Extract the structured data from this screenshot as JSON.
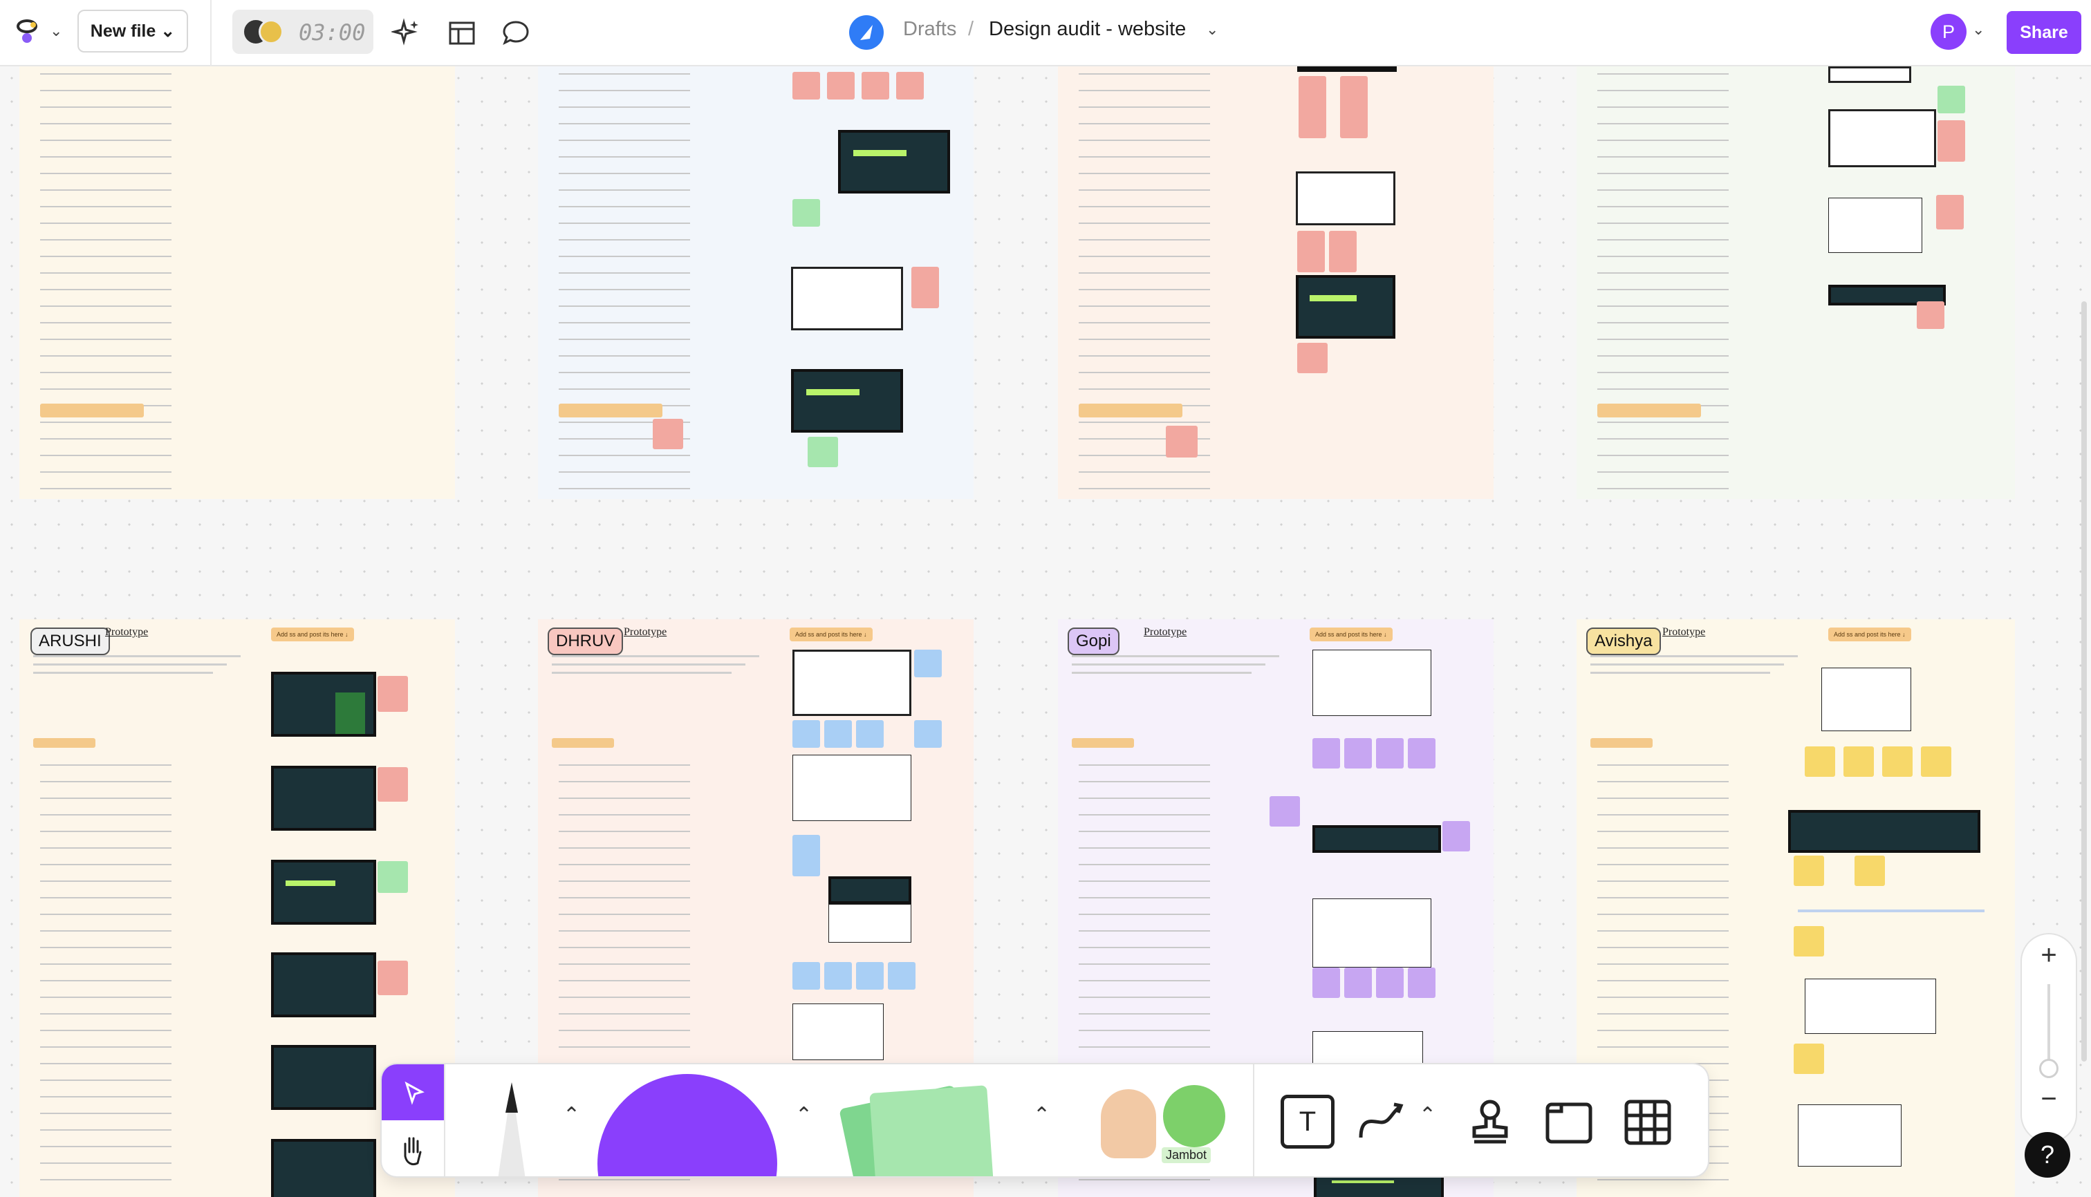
{
  "header": {
    "new_file_label": "New file",
    "timer": "03:00",
    "breadcrumb_root": "Drafts",
    "breadcrumb_sep": "/",
    "file_title": "Design audit - website",
    "user_initial": "P",
    "share_label": "Share"
  },
  "boards": {
    "arushi": {
      "name": "ARUSHI",
      "prototype": "Prototype",
      "add_button": "Add ss and post its here ↓"
    },
    "dhruv": {
      "name": "DHRUV",
      "prototype": "Prototype",
      "add_button": "Add ss and post its here ↓"
    },
    "gopi": {
      "name": "Gopi",
      "prototype": "Prototype",
      "add_button": "Add ss and post its here ↓"
    },
    "avishya": {
      "name": "Avishya",
      "prototype": "Prototype",
      "add_button": "Add ss and post its here ↓"
    }
  },
  "toolbar": {
    "jambot_label": "Jambot",
    "text_tool": "T"
  },
  "zoom": {
    "plus": "+",
    "minus": "−"
  },
  "help_label": "?",
  "colors": {
    "accent": "#8a3ffc",
    "sticky_red": "#f2a8a0",
    "sticky_green": "#a6e6ae",
    "sticky_blue": "#a9cff5",
    "sticky_purple": "#c7a6f2",
    "sticky_yellow": "#f7d86a"
  },
  "icons": {
    "app_logo": "figjam-logo-icon",
    "ai": "sparkle-icon",
    "layout": "layout-icon",
    "comment": "comment-icon",
    "file": "rocket-file-icon"
  }
}
